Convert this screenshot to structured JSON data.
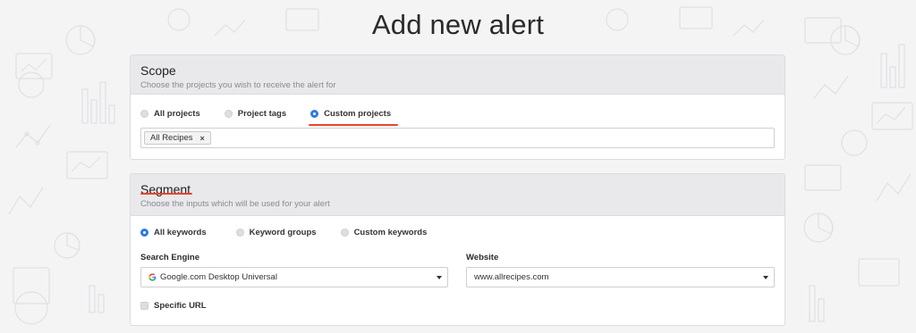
{
  "page": {
    "title": "Add new alert"
  },
  "scope": {
    "title": "Scope",
    "subtitle": "Choose the projects you wish to receive the alert for",
    "options": [
      {
        "label": "All projects",
        "selected": false
      },
      {
        "label": "Project tags",
        "selected": false
      },
      {
        "label": "Custom projects",
        "selected": true
      }
    ],
    "tags": [
      {
        "label": "All Recipes",
        "remove": "×"
      }
    ]
  },
  "segment": {
    "title": "Segment",
    "subtitle": "Choose the inputs which will be used for your alert",
    "options": [
      {
        "label": "All keywords",
        "selected": true
      },
      {
        "label": "Keyword groups",
        "selected": false
      },
      {
        "label": "Custom keywords",
        "selected": false
      }
    ],
    "search_engine": {
      "label": "Search Engine",
      "value": "Google.com Desktop Universal",
      "icon": "google-icon"
    },
    "website": {
      "label": "Website",
      "value": "www.allrecipes.com"
    },
    "specific_url": {
      "label": "Specific URL",
      "checked": false
    }
  },
  "colors": {
    "accent": "#2d7ae0",
    "annotation": "#e8452c",
    "header_bg": "#e9e9ec",
    "page_bg": "#f4f4f5"
  }
}
